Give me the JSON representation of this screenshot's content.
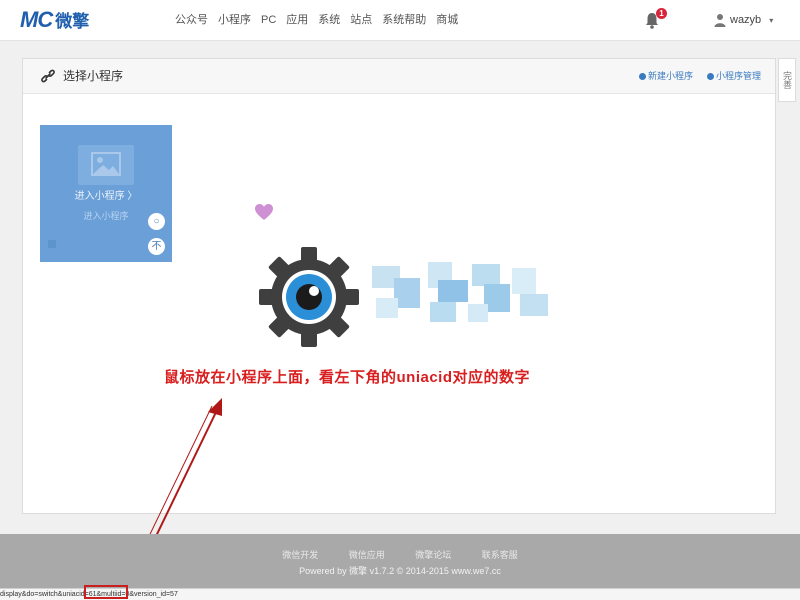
{
  "navbar": {
    "logo_mark": "MC",
    "logo_text": "微擎",
    "menu": [
      "公众号",
      "小程序",
      "PC",
      "应用",
      "系统",
      "站点",
      "系统帮助",
      "商城"
    ],
    "notification_count": "1",
    "user_name": "wazyb",
    "user_caret": "▾"
  },
  "panel": {
    "title": "选择小程序",
    "new_link": "新建小程序",
    "manage_link": "小程序管理",
    "side_tab": "完善"
  },
  "card": {
    "enter_label": "进入小程序 〉",
    "sub_label": "进入小程序",
    "btn_top": "○",
    "btn_bottom": "不"
  },
  "annotation": "鼠标放在小程序上面，看左下角的uniacid对应的数字",
  "footer": {
    "links": [
      "微信开发",
      "微信应用",
      "微擎论坛",
      "联系客服"
    ],
    "copyright": "Powered by 微擎 v1.7.2 © 2014-2015 www.we7.cc"
  },
  "statusbar": {
    "part1": "display&do=switch&",
    "part2": "uniacid=61",
    "part3": "&multiid=0&version_id=57"
  },
  "colors": {
    "accent": "#1f5fae",
    "card": "#6a9fd8",
    "annotation": "#d81e1e",
    "footer": "#a9a9a9"
  },
  "icons": {
    "panel_title": "link-icon",
    "notification": "bell-icon",
    "user": "user-icon",
    "card_image": "image-placeholder-icon",
    "heart": "heart-icon",
    "logo": "gear-eye-logo"
  }
}
